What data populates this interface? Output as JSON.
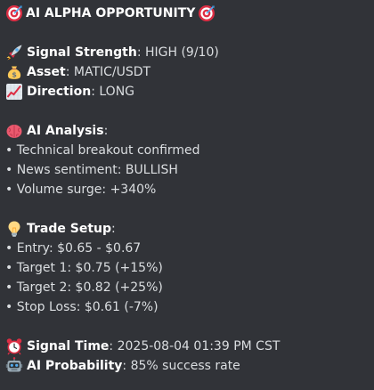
{
  "header": {
    "title": "AI ALPHA OPPORTUNITY",
    "left_icon": "target-icon",
    "right_icon": "target-icon"
  },
  "signal": {
    "strength_label": "Signal Strength",
    "strength_value": "HIGH (9/10)",
    "asset_label": "Asset",
    "asset_value": "MATIC/USDT",
    "direction_label": "Direction",
    "direction_value": "LONG"
  },
  "analysis": {
    "heading": "AI Analysis",
    "items": [
      "• Technical breakout confirmed",
      "• News sentiment: BULLISH",
      "• Volume surge: +340%"
    ]
  },
  "trade_setup": {
    "heading": "Trade Setup",
    "items": [
      "• Entry: $0.65 - $0.67",
      "• Target 1: $0.75 (+15%)",
      "• Target 2: $0.82 (+25%)",
      "• Stop Loss: $0.61 (-7%)"
    ]
  },
  "footer": {
    "time_label": "Signal Time",
    "time_value": "2025-08-04 01:39 PM CST",
    "probability_label": "AI Probability",
    "probability_value": "85% success rate"
  },
  "colors": {
    "background": "#313338",
    "text": "#dbdee1",
    "bold_text": "#ffffff"
  }
}
